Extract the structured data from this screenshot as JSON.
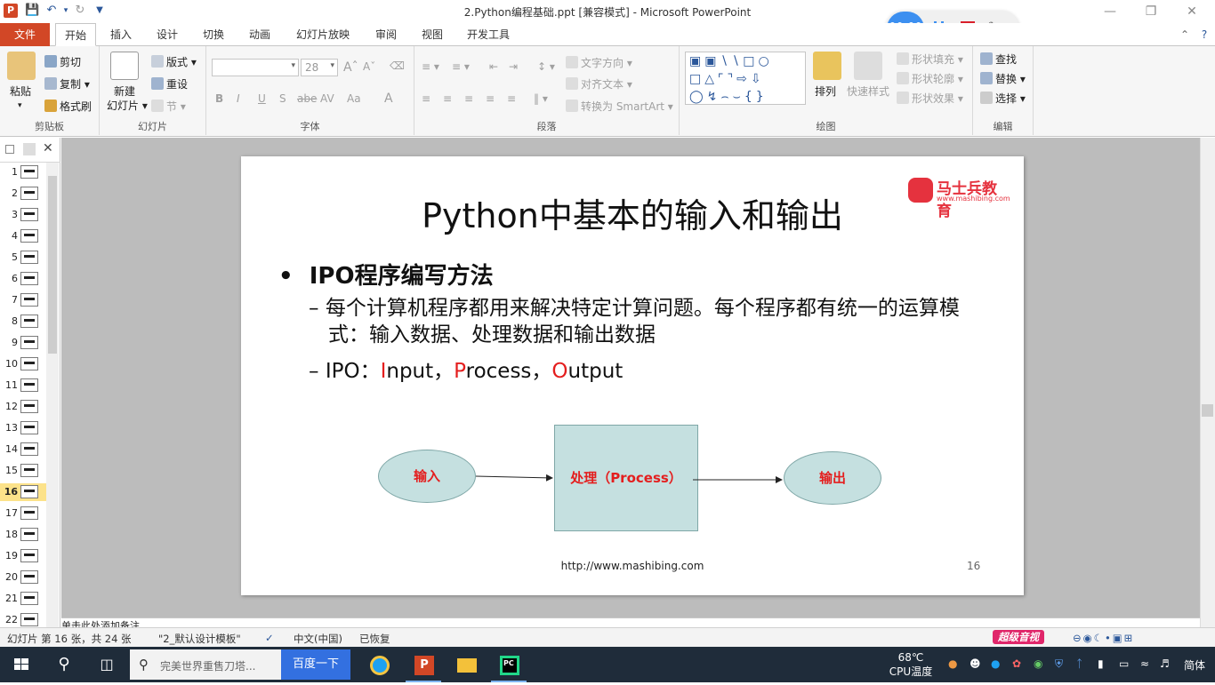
{
  "window": {
    "title": "2.Python编程基础.ppt [兼容模式]  -  Microsoft PowerPoint",
    "app_icon": "P"
  },
  "recorder": {
    "timer": "00:00"
  },
  "tabs": {
    "file": "文件",
    "items": [
      "开始",
      "插入",
      "设计",
      "切换",
      "动画",
      "幻灯片放映",
      "审阅",
      "视图",
      "开发工具"
    ]
  },
  "ribbon": {
    "clipboard": {
      "paste": "粘贴",
      "cut": "剪切",
      "copy": "复制",
      "format_painter": "格式刷",
      "label": "剪贴板"
    },
    "slides": {
      "new_slide_1": "新建",
      "new_slide_2": "幻灯片",
      "layout": "版式",
      "reset": "重设",
      "section": "节",
      "label": "幻灯片"
    },
    "font": {
      "size": "28",
      "label": "字体",
      "bold": "B",
      "italic": "I",
      "underline": "U",
      "shadow": "S",
      "strike": "abe",
      "spacing": "AV",
      "case": "Aa",
      "color": "A"
    },
    "paragraph": {
      "text_direction": "文字方向",
      "align_text": "对齐文本",
      "smartart": "转换为 SmartArt",
      "label": "段落"
    },
    "drawing": {
      "arrange": "排列",
      "quick_styles": "快速样式",
      "shape_fill": "形状填充",
      "shape_outline": "形状轮廓",
      "shape_effects": "形状效果",
      "label": "绘图"
    },
    "editing": {
      "find": "查找",
      "replace": "替换",
      "select": "选择",
      "label": "编辑"
    }
  },
  "thumbnails": {
    "numbers": [
      "1",
      "2",
      "3",
      "4",
      "5",
      "6",
      "7",
      "8",
      "9",
      "10",
      "11",
      "12",
      "13",
      "14",
      "15",
      "16",
      "17",
      "18",
      "19",
      "20",
      "21",
      "22"
    ],
    "selected": "16"
  },
  "slide": {
    "title": "Python中基本的输入和输出",
    "logo_text": "马士兵教育",
    "logo_url": "www.mashibing.com",
    "bullet_main": "IPO程序编写方法",
    "bullet_sub1": "每个计算机程序都用来解决特定计算问题。每个程序都有统一的运算模式：输入数据、处理数据和输出数据",
    "bullet_sub2_prefix": "IPO：",
    "ipo_I": "I",
    "ipo_I_rest": "nput，",
    "ipo_P": "P",
    "ipo_P_rest": "rocess，",
    "ipo_O": "O",
    "ipo_O_rest": "utput",
    "input_node": "输入",
    "process_node": "处理（Process）",
    "output_node": "输出",
    "footer_url": "http://www.mashibing.com",
    "page_number": "16",
    "dash": "–",
    "bullet": "•"
  },
  "notes": {
    "placeholder": "单击此处添加备注"
  },
  "status": {
    "slide_info": "幻灯片 第 16 张，共 24 张",
    "theme": "\"2_默认设计模板\"",
    "language": "中文(中国)",
    "recovered": "已恢复",
    "promo": "超级音视"
  },
  "taskbar": {
    "search_placeholder": "完美世界重售刀塔...",
    "baidu": "百度一下",
    "temp": "68℃",
    "temp_label": "CPU温度",
    "ime": "简体"
  }
}
